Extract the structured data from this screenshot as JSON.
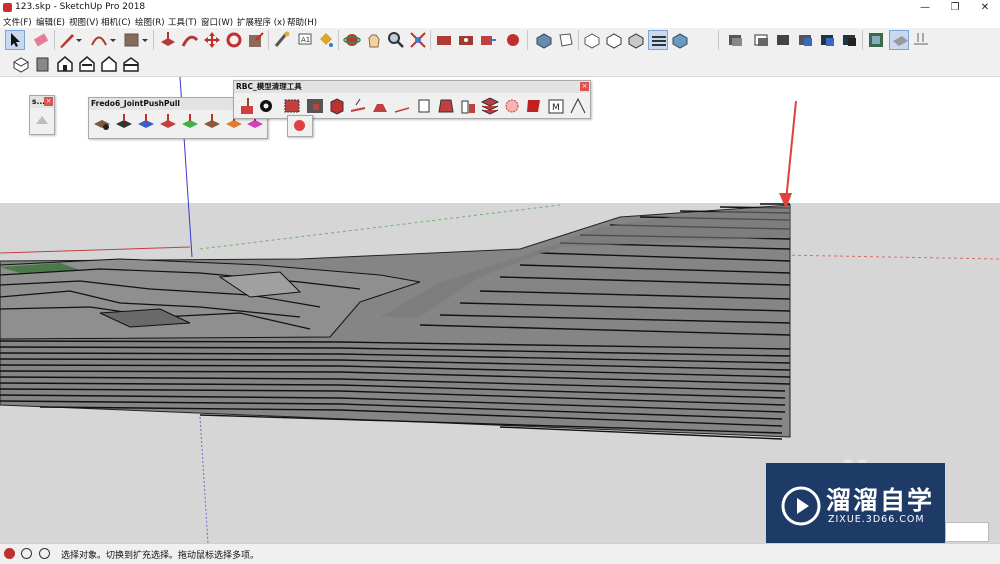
{
  "window": {
    "title": "123.skp - SketchUp Pro 2018"
  },
  "menu": [
    "文件(F)",
    "编辑(E)",
    "视图(V)",
    "相机(C)",
    "绘图(R)",
    "工具(T)",
    "窗口(W)",
    "扩展程序 (x)",
    "帮助(H)"
  ],
  "palettes": {
    "small": {
      "title": "s..."
    },
    "fredo": {
      "title": "Fredo6_JointPushPull"
    },
    "rbc": {
      "title": "RBC_模型清理工具"
    }
  },
  "status": {
    "text": "选择对象。切换到扩充选择。拖动鼠标选择多项。"
  },
  "watermark": {
    "name": "溜溜自学",
    "url": "ZIXUE.3D66.COM"
  },
  "colors": {
    "accent": "#1e3a67",
    "arrow": "#e0413a",
    "layer_fill": "#7f7f7f",
    "ground": "#d6d6d6"
  }
}
